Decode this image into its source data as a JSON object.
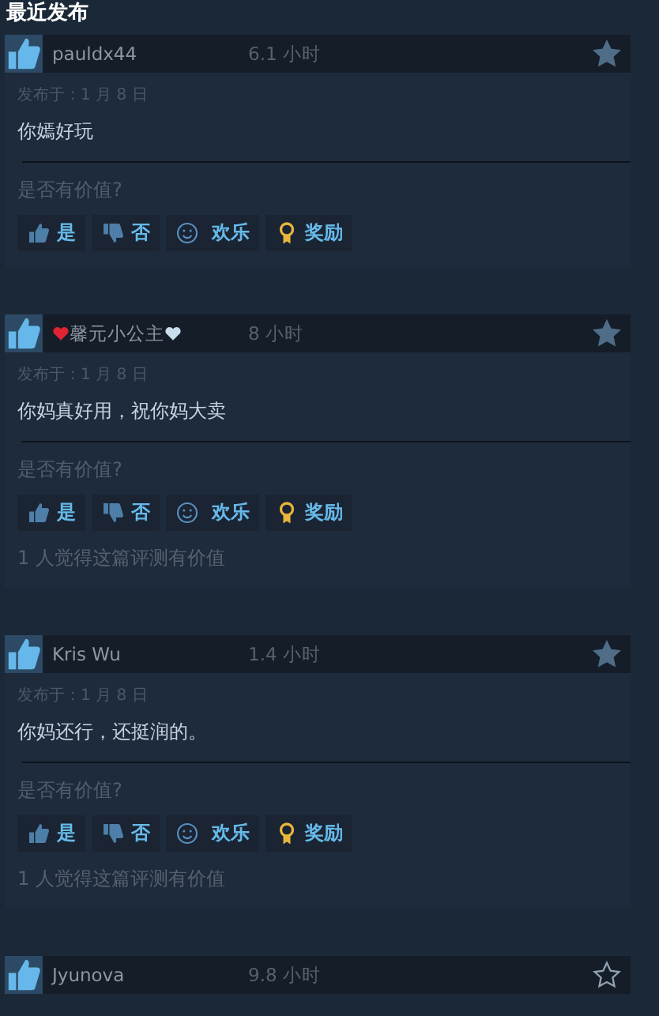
{
  "section_title": "最近发布",
  "reviews": [
    {
      "name": "pauldx44",
      "time": "6.1 小时",
      "starred": true,
      "date": "发布于：1 月 8 日",
      "text": "你嫣好玩",
      "helpful_prompt": "是否有价值?",
      "actions": [
        {
          "kind": "yes",
          "label": "是"
        },
        {
          "kind": "no",
          "label": "否"
        },
        {
          "kind": "funny",
          "label": "欢乐"
        },
        {
          "kind": "award",
          "label": "奖励"
        }
      ]
    },
    {
      "name": "馨元小公主",
      "heart_badges": true,
      "time": "8 小时",
      "starred": true,
      "date": "发布于：1 月 8 日",
      "text": "你妈真好用，祝你妈大卖",
      "helpful_prompt": "是否有价值?",
      "actions": [
        {
          "kind": "yes",
          "label": "是"
        },
        {
          "kind": "no",
          "label": "否"
        },
        {
          "kind": "funny",
          "label": "欢乐"
        },
        {
          "kind": "award",
          "label": "奖励"
        }
      ],
      "helpful_count": "1 人觉得这篇评测有价值"
    },
    {
      "name": "Kris Wu",
      "time": "1.4 小时",
      "starred": true,
      "date": "发布于：1 月 8 日",
      "text": "你妈还行，还挺润的。",
      "helpful_prompt": "是否有价值?",
      "actions": [
        {
          "kind": "yes",
          "label": "是"
        },
        {
          "kind": "no",
          "label": "否"
        },
        {
          "kind": "funny",
          "label": "欢乐"
        },
        {
          "kind": "award",
          "label": "奖励"
        }
      ],
      "helpful_count": "1 人觉得这篇评测有价值"
    },
    {
      "name": "Jyunova",
      "time": "9.8 小时",
      "starred": false
    }
  ]
}
